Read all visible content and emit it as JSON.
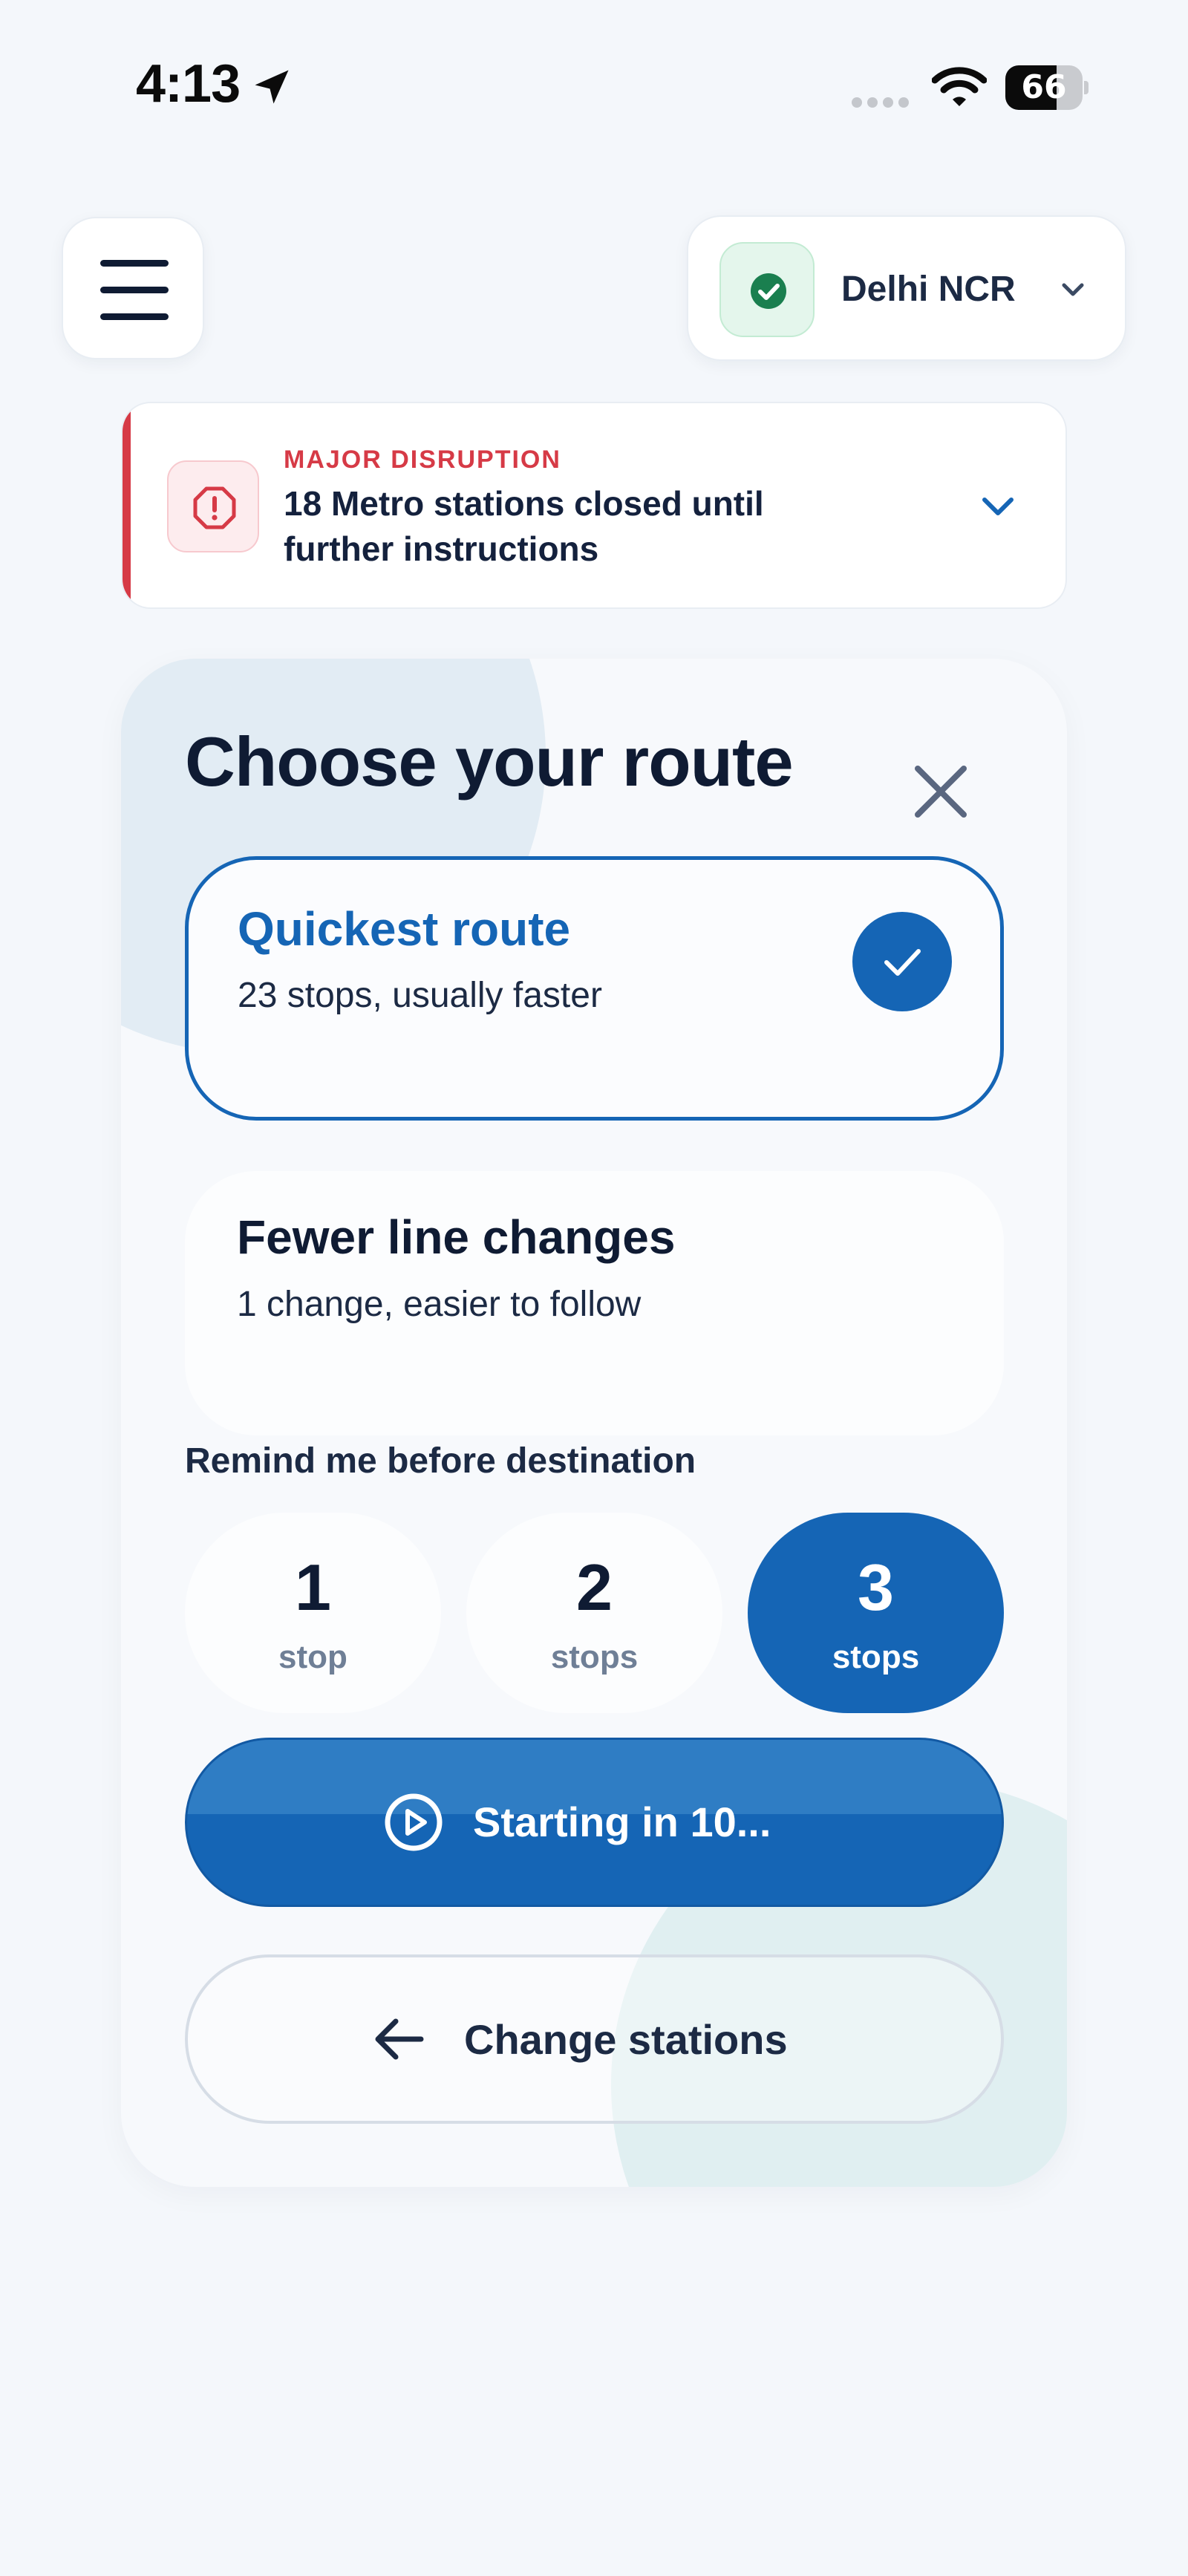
{
  "status_bar": {
    "time": "4:13",
    "battery_level": 66,
    "battery_text": "66",
    "icons": [
      "location-arrow-icon",
      "cellular-signal-icon",
      "wifi-icon",
      "battery-icon"
    ]
  },
  "header": {
    "menu_icon": "hamburger-menu-icon",
    "region": {
      "label": "Delhi NCR",
      "status_icon": "check-circle-icon",
      "dropdown_icon": "chevron-down-icon"
    }
  },
  "alert": {
    "tag": "MAJOR DISRUPTION",
    "message": "18 Metro stations closed until further instructions",
    "icon": "alert-octagon-icon",
    "expand_icon": "chevron-down-icon"
  },
  "route_panel": {
    "title": "Choose your route",
    "close_icon": "close-icon",
    "options": [
      {
        "title": "Quickest route",
        "subtitle": "23 stops, usually faster",
        "selected": true
      },
      {
        "title": "Fewer line changes",
        "subtitle": "1 change, easier to follow",
        "selected": false
      }
    ],
    "remind": {
      "label": "Remind me before destination",
      "choices": [
        {
          "number": "1",
          "unit": "stop",
          "selected": false
        },
        {
          "number": "2",
          "unit": "stops",
          "selected": false
        },
        {
          "number": "3",
          "unit": "stops",
          "selected": true
        }
      ]
    },
    "start_button": {
      "label": "Starting in 10...",
      "icon": "play-circle-icon"
    },
    "change_button": {
      "label": "Change stations",
      "icon": "arrow-left-icon"
    }
  },
  "colors": {
    "accent": "#1565b5",
    "danger": "#d63a46",
    "success": "#1a7f4f",
    "background": "#f4f7fb"
  }
}
